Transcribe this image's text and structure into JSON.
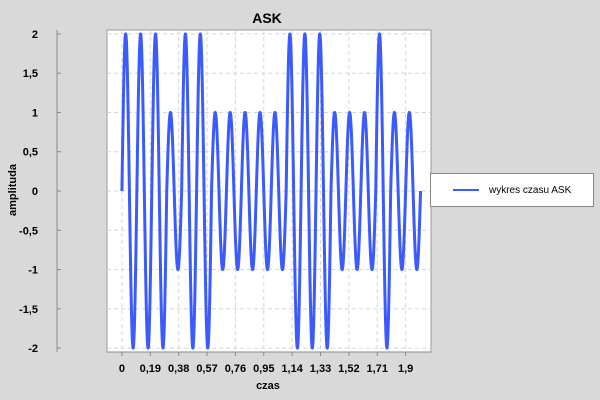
{
  "chart_data": {
    "type": "line",
    "title": "ASK",
    "xlabel": "czas",
    "ylabel": "amplituda",
    "xlim": [
      -0.1,
      2.07
    ],
    "ylim": [
      -2.05,
      2.05
    ],
    "x_ticks": [
      {
        "value": 0,
        "label": "0"
      },
      {
        "value": 0.19,
        "label": "0,19"
      },
      {
        "value": 0.38,
        "label": "0,38"
      },
      {
        "value": 0.57,
        "label": "0,57"
      },
      {
        "value": 0.76,
        "label": "0,76"
      },
      {
        "value": 0.95,
        "label": "0,95"
      },
      {
        "value": 1.14,
        "label": "1,14"
      },
      {
        "value": 1.33,
        "label": "1,33"
      },
      {
        "value": 1.52,
        "label": "1,52"
      },
      {
        "value": 1.71,
        "label": "1,71"
      },
      {
        "value": 1.9,
        "label": "1,9"
      }
    ],
    "y_ticks": [
      {
        "value": 2,
        "label": "2"
      },
      {
        "value": 1.5,
        "label": "1,5"
      },
      {
        "value": 1,
        "label": "1"
      },
      {
        "value": 0.5,
        "label": "0,5"
      },
      {
        "value": 0,
        "label": "0"
      },
      {
        "value": -0.5,
        "label": "-0,5"
      },
      {
        "value": -1,
        "label": "-1"
      },
      {
        "value": -1.5,
        "label": "-1,5"
      },
      {
        "value": -2,
        "label": "-2"
      }
    ],
    "grid": true,
    "legend_position": "right",
    "series": [
      {
        "name": "wykres czasu ASK",
        "color": "#3b5bff",
        "waveform": "sine",
        "x_start": 0,
        "x_end": 2.0,
        "cycle_period": 0.1,
        "bits": [
          1,
          1,
          1,
          0,
          1,
          1,
          0,
          0,
          0,
          0,
          0,
          1,
          1,
          1,
          0,
          0,
          0,
          1,
          0,
          0
        ],
        "amplitude_for_1": 2,
        "amplitude_for_0": 1
      }
    ]
  }
}
